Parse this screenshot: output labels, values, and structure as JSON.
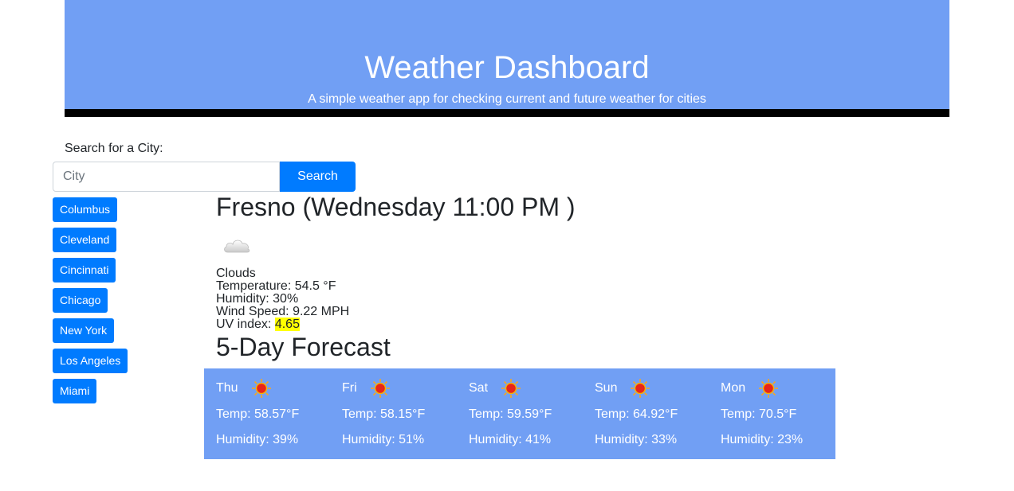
{
  "header": {
    "title": "Weather Dashboard",
    "subtitle": "A simple weather app for checking current and future weather for cities"
  },
  "search": {
    "label": "Search for a City:",
    "placeholder": "City",
    "value": "",
    "button_label": "Search"
  },
  "cities": [
    "Columbus",
    "Cleveland",
    "Cincinnati",
    "Chicago",
    "New York",
    "Los Angeles",
    "Miami"
  ],
  "current": {
    "heading": "Fresno (Wednesday 11:00 PM )",
    "icon": "cloud-icon",
    "condition": "Clouds",
    "temperature_label": "Temperature:",
    "temperature": "54.5 °F",
    "humidity_label": "Humidity:",
    "humidity": "30%",
    "wind_label": "Wind Speed:",
    "wind": "9.22 MPH",
    "uv_label": "UV index:",
    "uv": "4.65"
  },
  "forecast": {
    "title": "5-Day Forecast",
    "days": [
      {
        "day": "Thu",
        "icon": "sun-icon",
        "temp": "Temp: 58.57°F",
        "humidity": "Humidity: 39%"
      },
      {
        "day": "Fri",
        "icon": "sun-icon",
        "temp": "Temp: 58.15°F",
        "humidity": "Humidity: 51%"
      },
      {
        "day": "Sat",
        "icon": "sun-icon",
        "temp": "Temp: 59.59°F",
        "humidity": "Humidity: 41%"
      },
      {
        "day": "Sun",
        "icon": "sun-icon",
        "temp": "Temp: 64.92°F",
        "humidity": "Humidity: 33%"
      },
      {
        "day": "Mon",
        "icon": "sun-icon",
        "temp": "Temp: 70.5°F",
        "humidity": "Humidity: 23%"
      }
    ]
  },
  "colors": {
    "header_bg": "#719ff4",
    "button_bg": "#007bff",
    "uv_highlight": "#ffff00",
    "header_border": "#000000"
  }
}
